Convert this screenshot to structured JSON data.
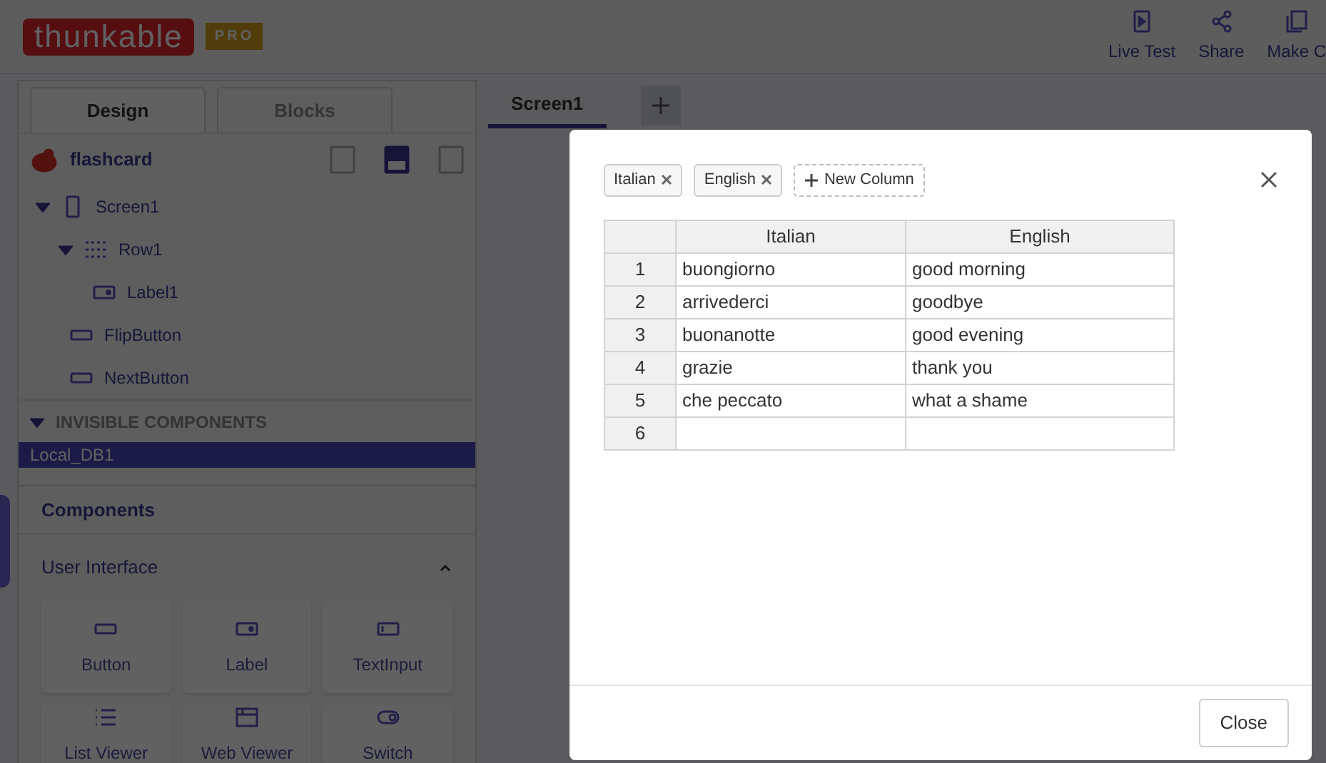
{
  "header": {
    "logo": "thunkable",
    "plan_badge": "PRO",
    "actions": [
      {
        "label": "Live Test",
        "kind": "live"
      },
      {
        "label": "Share",
        "kind": "share"
      },
      {
        "label": "Make C",
        "kind": "copy"
      }
    ]
  },
  "editor_tabs": [
    {
      "label": "Design",
      "selected": true
    },
    {
      "label": "Blocks",
      "selected": false
    }
  ],
  "screen_tabs": [
    {
      "label": "Screen1",
      "selected": true
    }
  ],
  "project": {
    "name": "flashcard",
    "layouts": [
      {
        "selected": false
      },
      {
        "selected": true
      },
      {
        "selected": false
      }
    ]
  },
  "tree": [
    {
      "label": "Screen1",
      "kind": "screen",
      "expanded": true,
      "children": [
        {
          "label": "Row1",
          "kind": "row",
          "expanded": true,
          "children": [
            {
              "label": "Label1",
              "kind": "label"
            }
          ]
        },
        {
          "label": "FlipButton",
          "kind": "button"
        },
        {
          "label": "NextButton",
          "kind": "button"
        }
      ]
    }
  ],
  "invisible": {
    "heading": "INVISIBLE COMPONENTS",
    "expanded": true,
    "items": [
      {
        "label": "Local_DB1",
        "selected": true
      }
    ]
  },
  "components": {
    "title": "Components",
    "sections": [
      {
        "title": "User Interface",
        "expanded": true,
        "items": [
          {
            "label": "Button",
            "kind": "button"
          },
          {
            "label": "Label",
            "kind": "label"
          },
          {
            "label": "TextInput",
            "kind": "textinput"
          },
          {
            "label": "List Viewer",
            "kind": "list"
          },
          {
            "label": "Web Viewer",
            "kind": "web"
          },
          {
            "label": "Switch",
            "kind": "switch"
          }
        ]
      }
    ]
  },
  "modal": {
    "chips": [
      {
        "label": "Italian"
      },
      {
        "label": "English"
      }
    ],
    "new_column": "New Column",
    "table": {
      "columns": [
        "Italian",
        "English"
      ],
      "rows": [
        {
          "index": "1",
          "cells": [
            "buongiorno",
            "good morning"
          ]
        },
        {
          "index": "2",
          "cells": [
            "arrivederci",
            "goodbye"
          ]
        },
        {
          "index": "3",
          "cells": [
            "buonanotte",
            "good evening"
          ]
        },
        {
          "index": "4",
          "cells": [
            "grazie",
            "thank you"
          ]
        },
        {
          "index": "5",
          "cells": [
            "che peccato",
            "what a shame"
          ]
        },
        {
          "index": "6"
        }
      ]
    },
    "footer_button": "Close"
  }
}
